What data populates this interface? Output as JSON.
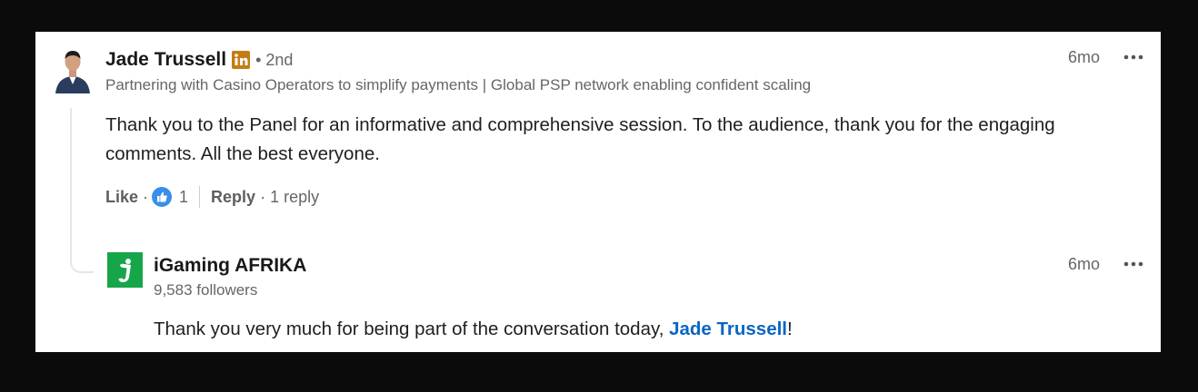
{
  "comment": {
    "author": "Jade Trussell",
    "degree": "• 2nd",
    "headline": "Partnering with Casino Operators to simplify payments | Global PSP network enabling confident scaling",
    "time": "6mo",
    "more_icon": "ellipsis-icon",
    "text": "Thank you to the Panel for an informative and comprehensive session. To the audience, thank you for the engaging comments. All the best everyone.",
    "like_label": "Like",
    "dot": "·",
    "reaction_count": "1",
    "reply_label": "Reply",
    "reply_count": "· 1 reply"
  },
  "reply": {
    "author": "iGaming AFRIKA",
    "followers": "9,583 followers",
    "time": "6mo",
    "text_before": "Thank you very much for being part of the conversation today, ",
    "mention": "Jade Trussell",
    "text_after": "!"
  },
  "colors": {
    "accent": "#0a66c2",
    "like": "#378fe9",
    "linkedin_badge": "#c37d16",
    "company_logo": "#17a54a"
  }
}
